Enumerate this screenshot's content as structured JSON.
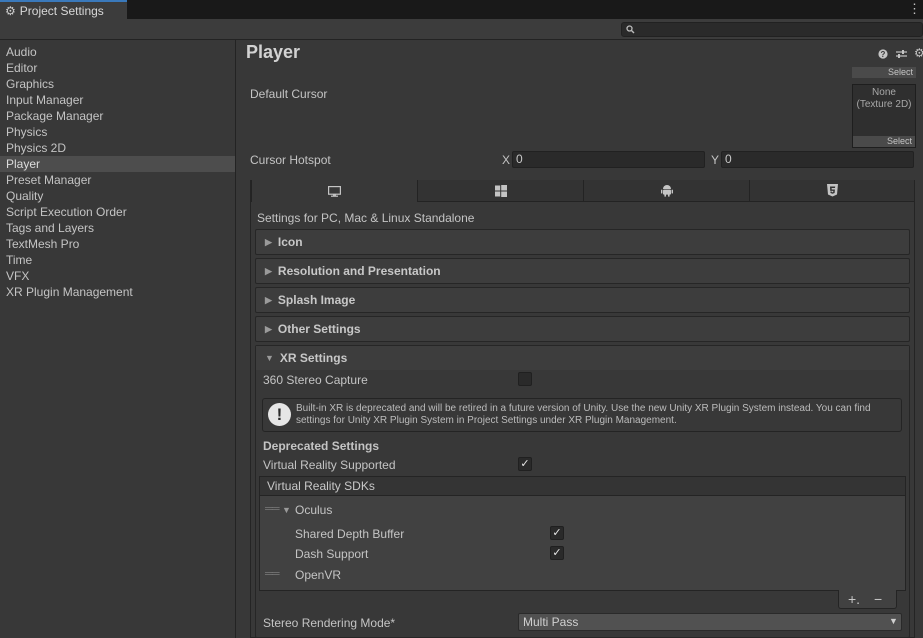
{
  "window": {
    "tab_title": "Project Settings",
    "kebab": "⋮"
  },
  "search": {
    "placeholder": ""
  },
  "sidebar": {
    "items": [
      {
        "label": "Audio"
      },
      {
        "label": "Editor"
      },
      {
        "label": "Graphics"
      },
      {
        "label": "Input Manager"
      },
      {
        "label": "Package Manager"
      },
      {
        "label": "Physics"
      },
      {
        "label": "Physics 2D"
      },
      {
        "label": "Player",
        "selected": true
      },
      {
        "label": "Preset Manager"
      },
      {
        "label": "Quality"
      },
      {
        "label": "Script Execution Order"
      },
      {
        "label": "Tags and Layers"
      },
      {
        "label": "TextMesh Pro"
      },
      {
        "label": "Time"
      },
      {
        "label": "VFX"
      },
      {
        "label": "XR Plugin Management"
      }
    ]
  },
  "main": {
    "title": "Player",
    "header_icons": [
      "help-icon",
      "preset-icon",
      "settings-icon"
    ],
    "default_cursor": {
      "label": "Default Cursor",
      "value_line1": "None",
      "value_line2": "(Texture 2D)",
      "select_label": "Select"
    },
    "cursor_hotspot": {
      "label": "Cursor Hotspot",
      "x_label": "X",
      "x_value": "0",
      "y_label": "Y",
      "y_value": "0"
    },
    "platform_tabs": [
      {
        "icon": "monitor-icon",
        "selected": true
      },
      {
        "icon": "windows-icon"
      },
      {
        "icon": "android-icon"
      },
      {
        "icon": "html5-icon"
      }
    ],
    "platform_caption": "Settings for PC, Mac & Linux Standalone",
    "sections": [
      {
        "label": "Icon"
      },
      {
        "label": "Resolution and Presentation"
      },
      {
        "label": "Splash Image"
      },
      {
        "label": "Other Settings"
      }
    ],
    "xr": {
      "label": "XR Settings",
      "stereo_capture_label": "360 Stereo Capture",
      "stereo_capture_checked": false,
      "warning": "Built-in XR is deprecated and will be retired in a future version of Unity. Use the new Unity XR Plugin System instead. You can find settings for Unity XR Plugin System in Project Settings under XR Plugin Management.",
      "deprecated_label": "Deprecated Settings",
      "vr_supported_label": "Virtual Reality Supported",
      "vr_supported_checked": true,
      "sdks_label": "Virtual Reality SDKs",
      "sdks": {
        "oculus_label": "Oculus",
        "shared_depth_label": "Shared Depth Buffer",
        "shared_depth_checked": true,
        "dash_label": "Dash Support",
        "dash_checked": true,
        "openvr_label": "OpenVR"
      },
      "add_label": "+.",
      "remove_label": "−",
      "stereo_mode_label": "Stereo Rendering Mode*",
      "stereo_mode_value": "Multi Pass"
    }
  }
}
